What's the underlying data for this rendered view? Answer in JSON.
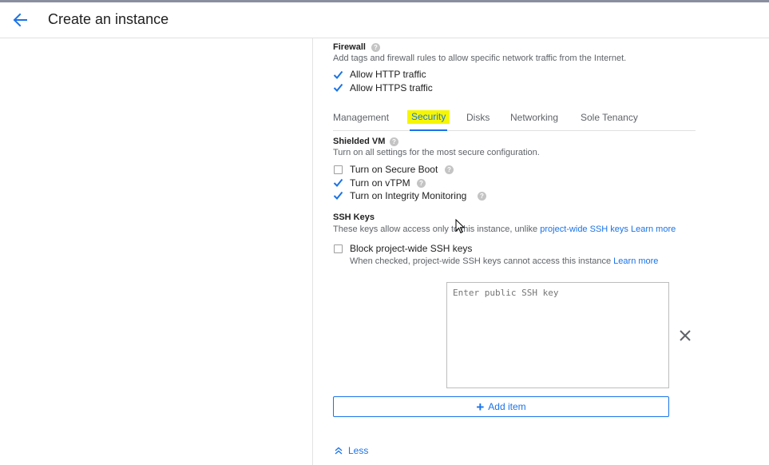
{
  "header": {
    "title": "Create an instance"
  },
  "firewall": {
    "heading": "Firewall",
    "description": "Add tags and firewall rules to allow specific network traffic from the Internet.",
    "options": [
      {
        "label": "Allow HTTP traffic",
        "checked": true
      },
      {
        "label": "Allow HTTPS traffic",
        "checked": true
      }
    ]
  },
  "tabs": [
    "Management",
    "Security",
    "Disks",
    "Networking",
    "Sole Tenancy"
  ],
  "active_tab": "Security",
  "shielded_vm": {
    "heading": "Shielded VM",
    "description": "Turn on all settings for the most secure configuration.",
    "options": [
      {
        "label": "Turn on Secure Boot",
        "checked": false
      },
      {
        "label": "Turn on vTPM",
        "checked": true
      },
      {
        "label": "Turn on Integrity Monitoring",
        "checked": true
      }
    ]
  },
  "ssh_keys": {
    "heading": "SSH Keys",
    "description_prefix": "These keys allow access only to this instance, unlike",
    "link_project_keys": "project-wide SSH keys",
    "link_learn_more": "Learn more",
    "block_label": "Block project-wide SSH keys",
    "block_checked": false,
    "block_note": "When checked, project-wide SSH keys cannot access this instance",
    "block_learn_more": "Learn more",
    "key_placeholder": "Enter public SSH key",
    "add_item_label": "Add item"
  },
  "less_label": "Less",
  "colors": {
    "accent": "#1a73e8",
    "highlight": "#f6f600"
  }
}
